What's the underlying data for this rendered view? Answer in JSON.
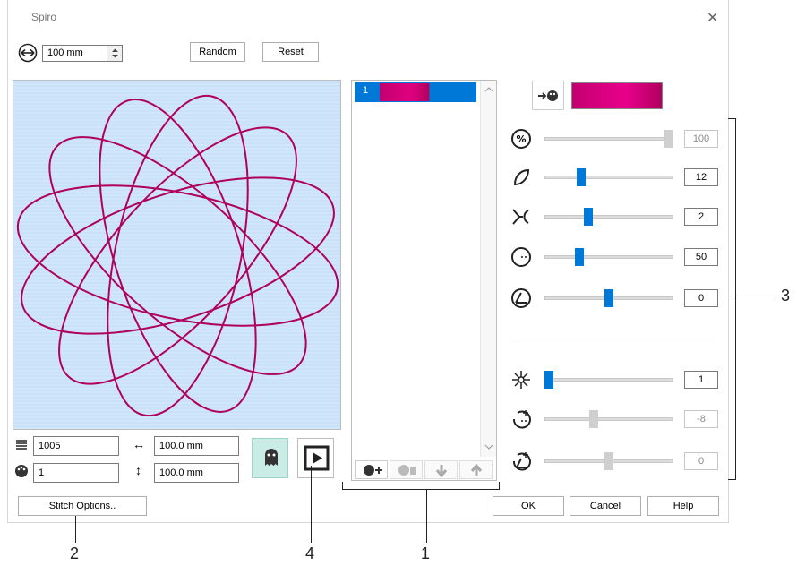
{
  "window": {
    "title": "Spiro",
    "close_glyph": "✕"
  },
  "top": {
    "size_value": "100 mm",
    "random_label": "Random",
    "reset_label": "Reset"
  },
  "stats": {
    "stitch_count": "1005",
    "width": "100.0 mm",
    "color_count": "1",
    "height": "100.0 mm"
  },
  "stitch_options_label": "Stitch Options..",
  "list": {
    "items": [
      {
        "index": "1"
      }
    ]
  },
  "list_toolbar": [
    "add-color-icon",
    "delete-color-icon",
    "move-down-icon",
    "move-up-icon"
  ],
  "sliders": [
    {
      "icon": "percent-icon",
      "value": "100",
      "level": 1.0,
      "disabled": true
    },
    {
      "icon": "petal-icon",
      "value": "12",
      "level": 0.27,
      "disabled": false
    },
    {
      "icon": "split-icon",
      "value": "2",
      "level": 0.33,
      "disabled": false
    },
    {
      "icon": "circle-radius-icon",
      "value": "50",
      "level": 0.25,
      "disabled": false
    },
    {
      "icon": "angle-icon",
      "value": "0",
      "level": 0.5,
      "disabled": false
    },
    {
      "icon": "flower-icon",
      "value": "1",
      "level": 0.0,
      "disabled": false
    },
    {
      "icon": "circle-radius-plus-icon",
      "value": "-8",
      "level": 0.37,
      "disabled": true
    },
    {
      "icon": "angle-plus-icon",
      "value": "0",
      "level": 0.5,
      "disabled": true
    }
  ],
  "footer": {
    "ok_label": "OK",
    "cancel_label": "Cancel",
    "help_label": "Help"
  },
  "callouts": [
    "1",
    "2",
    "3",
    "4"
  ],
  "colors": {
    "accent": "#0078d7",
    "thread": "#b0005e",
    "preview_bg": "#cfe6fb"
  }
}
